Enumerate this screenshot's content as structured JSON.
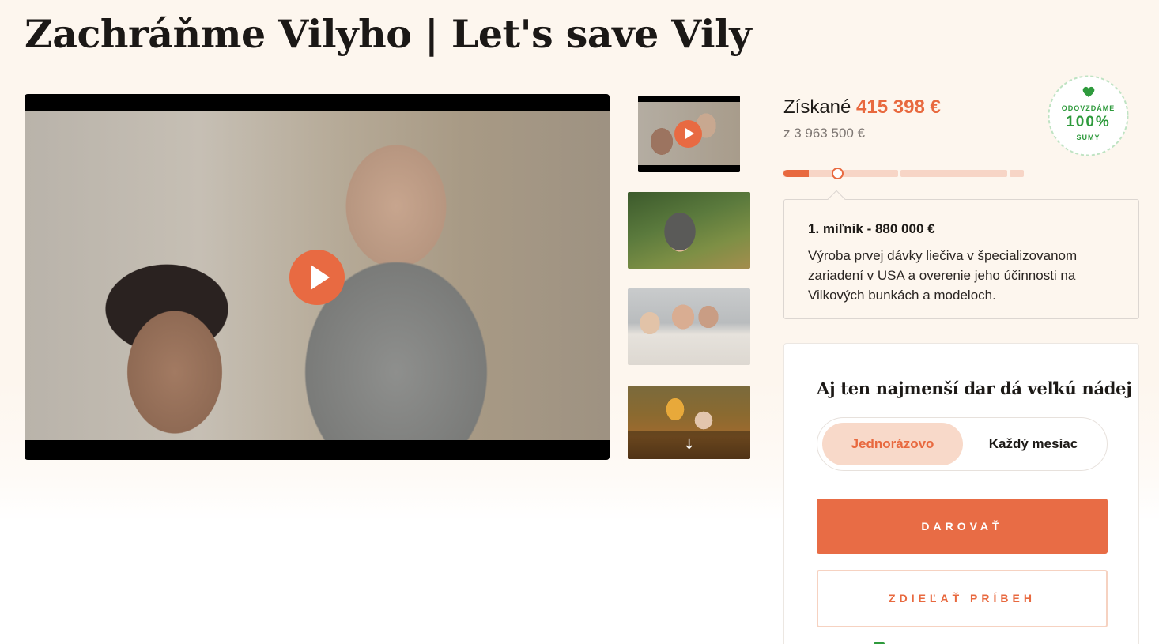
{
  "page": {
    "title": "Zachráňme Vilyho | Let's save Vily"
  },
  "media": {
    "main_video": {
      "kind": "video",
      "play_icon": "play-icon"
    },
    "thumbnails": [
      {
        "kind": "video",
        "icon": "play-icon"
      },
      {
        "kind": "image"
      },
      {
        "kind": "image"
      },
      {
        "kind": "image",
        "scroll_icon": "arrow-down-icon",
        "scroll_glyph": "↓"
      }
    ]
  },
  "funding": {
    "raised_label": "Získané",
    "raised_amount": "415 398 €",
    "goal_text": "z 3 963 500 €",
    "progress_fraction": 0.105
  },
  "badge": {
    "top": "ODOVZDÁME",
    "middle": "100%",
    "bottom": "SUMY",
    "icon": "heart-hands-icon"
  },
  "milestone": {
    "title": "1. míľnik - 880 000 €",
    "description": "Výroba prvej dávky liečiva v špecializovanom zariadení v USA a overenie jeho účinnosti na Vilkových bunkách a modeloch."
  },
  "donate": {
    "heading": "Aj ten najmenší dar dá veľkú nádej",
    "frequency_options": [
      "Jednorázovo",
      "Každý mesiac"
    ],
    "selected_frequency": "Jednorázovo",
    "donate_button": "DAROVAŤ",
    "share_button": "ZDIEĽAŤ PRÍBEH"
  },
  "colors": {
    "accent": "#e8693f",
    "accent_light": "#f8d9c9",
    "badge_green": "#2e9a3c",
    "background": "#fdf6ee"
  }
}
